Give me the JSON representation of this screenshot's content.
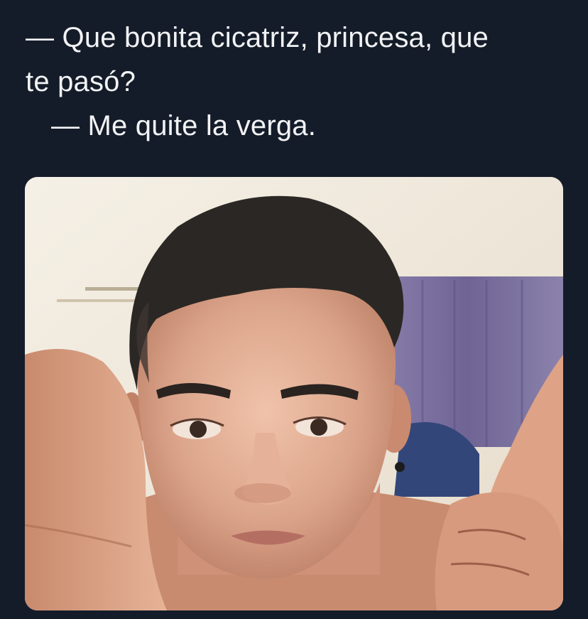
{
  "tweet": {
    "lines": [
      "— Que bonita cicatriz, princesa, que",
      "te pasó?",
      "— Me quite la verga."
    ]
  },
  "media": {
    "colors": {
      "wall": "#efe8d8",
      "curtain": "#7b6f9c",
      "hair": "#2e2a27",
      "skin": "#d9a388",
      "skin_shadow": "#b67b63"
    }
  }
}
